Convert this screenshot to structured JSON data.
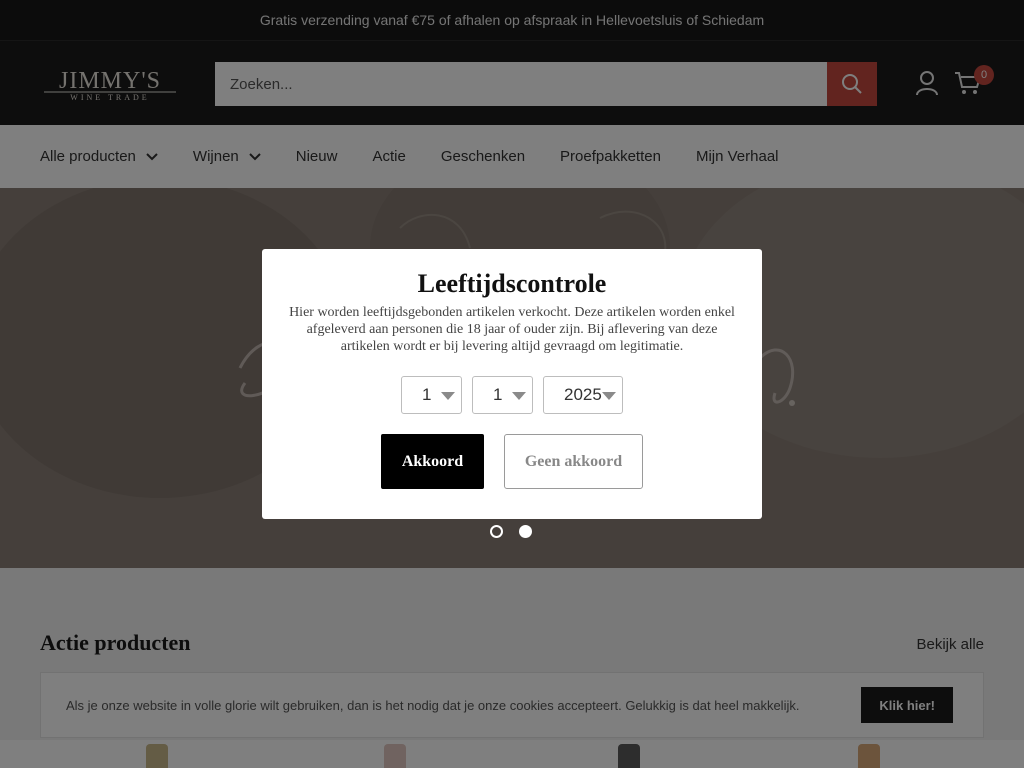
{
  "announcement": "Gratis verzending vanaf €75 of afhalen op afspraak in Hellevoetsluis of Schiedam",
  "header": {
    "logo_text": "JIMMY'S",
    "logo_subtext": "WINE TRADE",
    "search_placeholder": "Zoeken...",
    "cart_count": "0",
    "icons": [
      "search-icon",
      "account-icon",
      "cart-icon"
    ]
  },
  "nav": {
    "items": [
      {
        "label": "Alle producten",
        "dropdown": true
      },
      {
        "label": "Wijnen",
        "dropdown": true
      },
      {
        "label": "Nieuw",
        "dropdown": false
      },
      {
        "label": "Actie",
        "dropdown": false
      },
      {
        "label": "Geschenken",
        "dropdown": false
      },
      {
        "label": "Proefpakketten",
        "dropdown": false
      },
      {
        "label": "Mijn Verhaal",
        "dropdown": false
      }
    ]
  },
  "hero": {
    "slide_count": 2,
    "active_slide": 1
  },
  "section": {
    "title": "Actie producten",
    "view_all": "Bekijk alle"
  },
  "cookie": {
    "text": "Als je onze website in volle glorie wilt gebruiken, dan is het nodig dat je onze cookies accepteert. Gelukkig is dat heel makkelijk.",
    "button": "Klik hier!"
  },
  "age_modal": {
    "title": "Leeftijdscontrole",
    "text": "Hier worden leeftijdsgebonden artikelen verkocht. Deze artikelen worden enkel afgeleverd aan personen die 18 jaar of ouder zijn. Bij aflevering van deze artikelen wordt er bij levering altijd gevraagd om legitimatie.",
    "day": "1",
    "month": "1",
    "year": "2025",
    "accept": "Akkoord",
    "decline": "Geen akkoord"
  },
  "colors": {
    "accent": "#c5493f",
    "dark": "#1a1a1a"
  }
}
